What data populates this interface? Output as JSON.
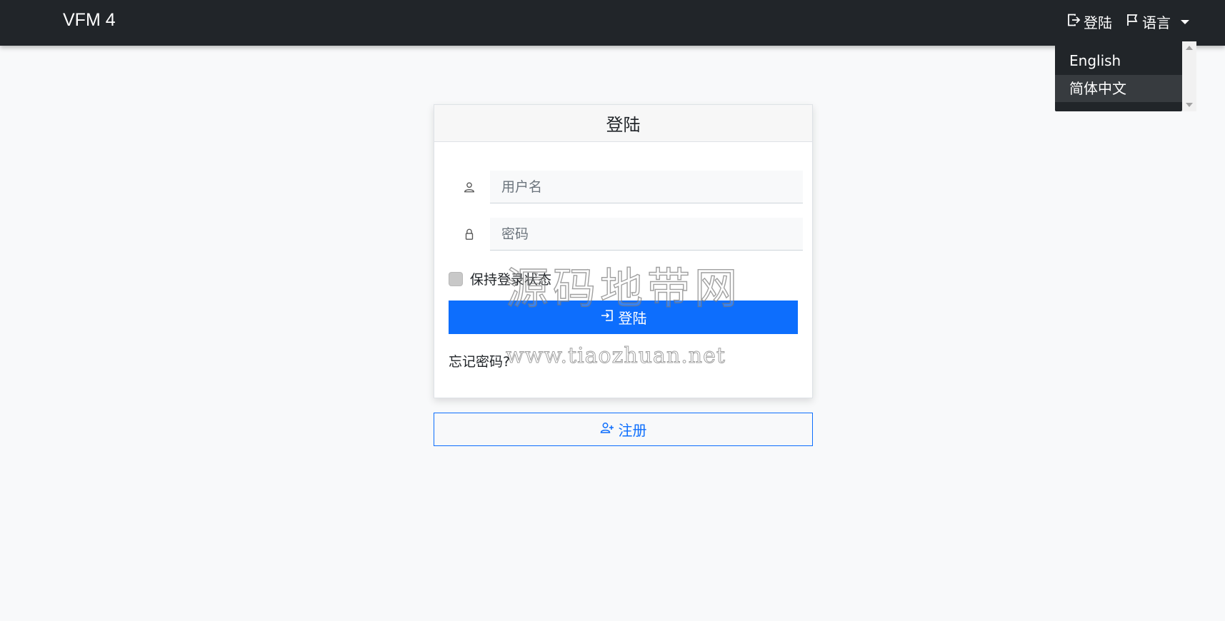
{
  "navbar": {
    "brand": "VFM 4",
    "login_label": "登陆",
    "language_label": "语言"
  },
  "language_dropdown": {
    "items": [
      {
        "label": "English",
        "active": false
      },
      {
        "label": "简体中文",
        "active": true
      }
    ]
  },
  "login_card": {
    "title": "登陆",
    "username_placeholder": "用户名",
    "password_placeholder": "密码",
    "remember_label": "保持登录状态",
    "submit_label": "登陆",
    "forgot_label": "忘记密码?"
  },
  "register": {
    "label": "注册"
  },
  "watermark": {
    "line1": "源码地带网",
    "line2": "www.tiaozhuan.net"
  },
  "colors": {
    "navbar_bg": "#212529",
    "primary": "#0d6efd",
    "page_bg": "#f8f9fa"
  }
}
